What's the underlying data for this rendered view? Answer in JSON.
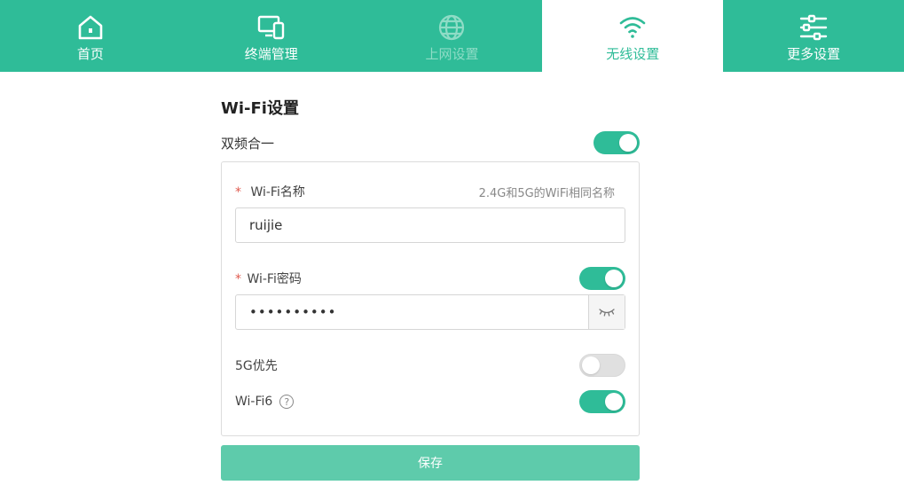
{
  "nav": {
    "tabs": [
      {
        "label": "首页",
        "icon": "home-icon",
        "state": "normal"
      },
      {
        "label": "终端管理",
        "icon": "devices-icon",
        "state": "normal"
      },
      {
        "label": "上网设置",
        "icon": "globe-icon",
        "state": "disabled"
      },
      {
        "label": "无线设置",
        "icon": "wifi-icon",
        "state": "active"
      },
      {
        "label": "更多设置",
        "icon": "sliders-icon",
        "state": "normal"
      }
    ]
  },
  "wifi": {
    "title": "Wi-Fi设置",
    "dual_band_label": "双频合一",
    "dual_band_on": true,
    "name": {
      "required_mark": "*",
      "label": "Wi-Fi名称",
      "hint": "2.4G和5G的WiFi相同名称",
      "value": "ruijie"
    },
    "password": {
      "required_mark": "*",
      "label": "Wi-Fi密码",
      "enabled": true,
      "masked_value": "••••••••••"
    },
    "prefer_5g": {
      "label": "5G优先",
      "on": false
    },
    "wifi6": {
      "label": "Wi-Fi6",
      "help": "?",
      "on": true
    },
    "save_label": "保存"
  },
  "colors": {
    "accent": "#2fbc98",
    "save_button": "#5ecbab",
    "required": "#e05a4f"
  }
}
